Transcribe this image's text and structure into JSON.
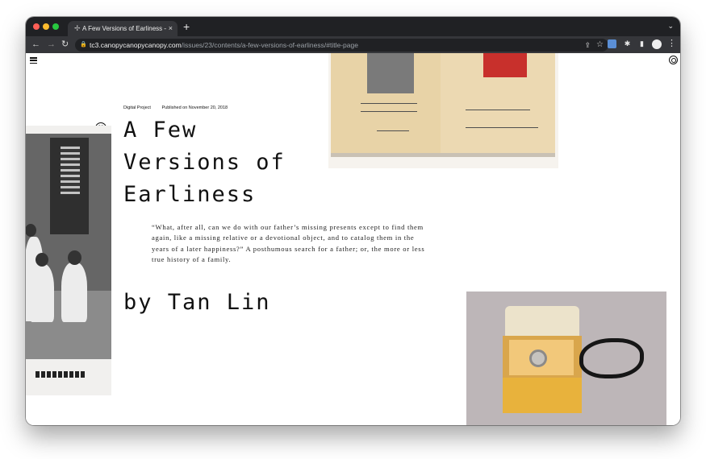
{
  "browser": {
    "tab": {
      "title": "A Few Versions of Earliness – T",
      "favicon": "globe-icon",
      "close": "×"
    },
    "new_tab": "+",
    "url": {
      "host": "tc3.canopycanopycanopy.com",
      "path": "/issues/23/contents/a-few-versions-of-earliness/#title-page"
    }
  },
  "article": {
    "category": "Digital Project",
    "published": "Published on November 20, 2018",
    "issue_number": "23",
    "title": "A Few Versions of Earliness",
    "quote": "“What, after all, can we do with our father’s missing presents except to find them again, like a missing relative or a devotional object, and to catalog them in the years of a later happiness?” A posthumous search for a father; or, the more or less true history of a family.",
    "author": "by Tan Lin"
  },
  "colors": {
    "tabbar": "#202124",
    "toolbar": "#35363a",
    "text": "#111111",
    "background": "#ffffff"
  }
}
